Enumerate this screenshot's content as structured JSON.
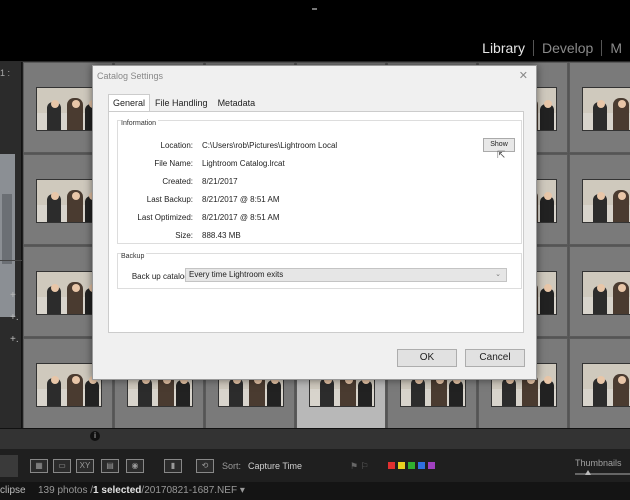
{
  "app": {
    "modules": [
      {
        "label": "Library",
        "active": true
      },
      {
        "label": "Develop",
        "active": false
      },
      {
        "label": "M",
        "active": false
      }
    ]
  },
  "left_panel": {
    "header": "1 :",
    "controls": [
      "+",
      "+.",
      "+."
    ]
  },
  "dialog": {
    "title": "Catalog Settings",
    "close_icon": "close-icon",
    "tabs": [
      {
        "label": "General",
        "active": true
      },
      {
        "label": "File Handling",
        "active": false
      },
      {
        "label": "Metadata",
        "active": false
      }
    ],
    "information": {
      "title": "Information",
      "rows": [
        {
          "label": "Location:",
          "value": "C:\\Users\\rob\\Pictures\\Lightroom Local"
        },
        {
          "label": "File Name:",
          "value": "Lightroom Catalog.lrcat"
        },
        {
          "label": "Created:",
          "value": "8/21/2017"
        },
        {
          "label": "Last Backup:",
          "value": "8/21/2017 @ 8:51 AM"
        },
        {
          "label": "Last Optimized:",
          "value": "8/21/2017 @ 8:51 AM"
        },
        {
          "label": "Size:",
          "value": "888.43 MB"
        }
      ],
      "show_button": "Show"
    },
    "backup": {
      "title": "Backup",
      "label": "Back up catalog:",
      "selected": "Every time Lightroom exits"
    },
    "ok_button": "OK",
    "cancel_button": "Cancel"
  },
  "toolbar": {
    "sort_label": "Sort:",
    "sort_value": "Capture Time",
    "thumbnails_label": "Thumbnails",
    "color_labels": [
      "#e03030",
      "#e8d020",
      "#30b030",
      "#3070e0",
      "#a040c0"
    ]
  },
  "statusbar": {
    "edge_text": "clipse",
    "count": "139 photos /",
    "selected": "1 selected",
    "filename": "/20170821-1687.NEF",
    "filename_suffix": " ▾"
  }
}
